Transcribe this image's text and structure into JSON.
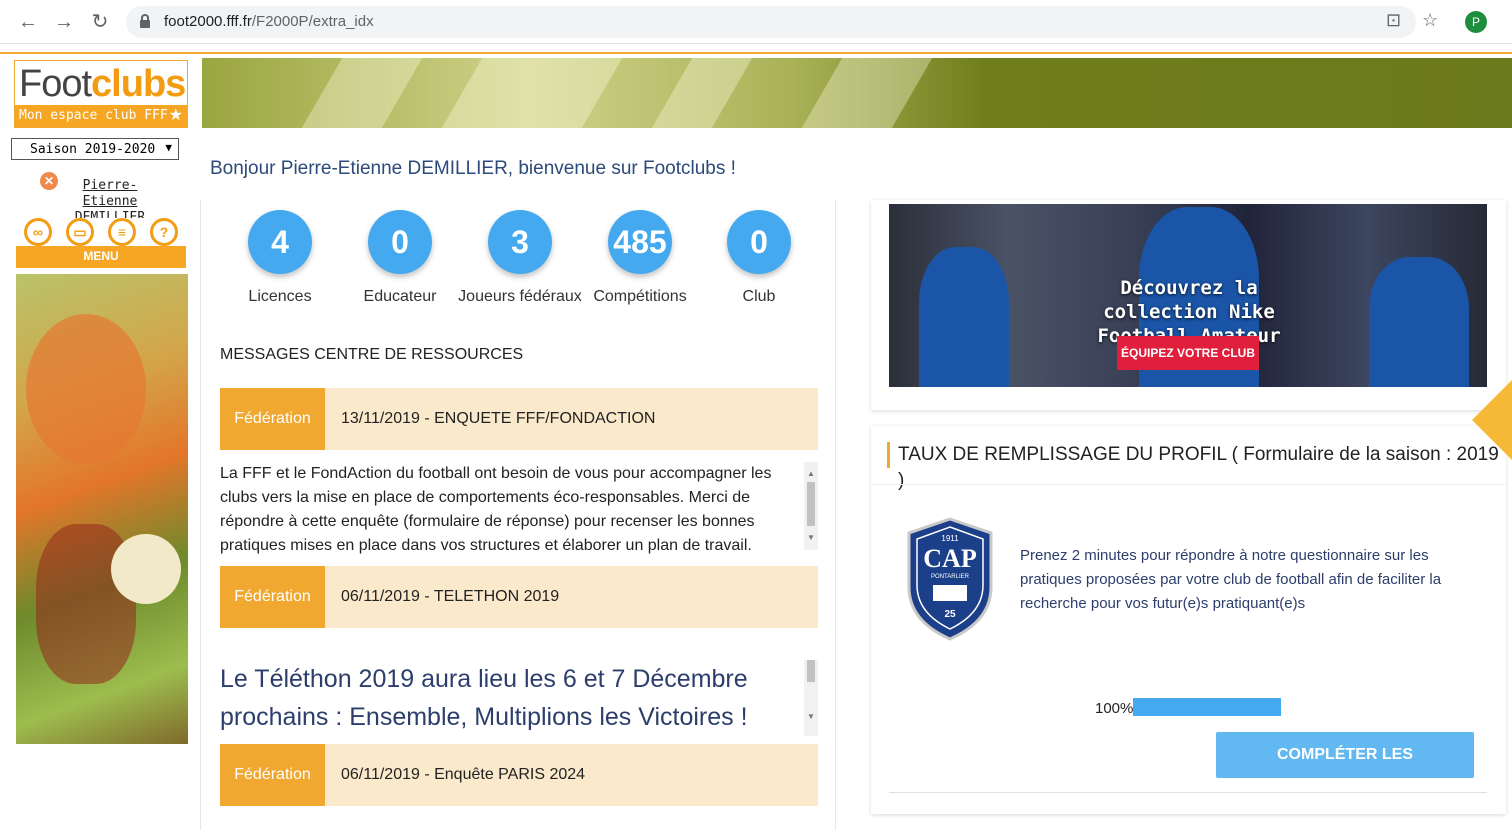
{
  "browser": {
    "url_host": "foot2000.fff.fr",
    "url_path": "/F2000P/extra_idx",
    "profile_initial": "P"
  },
  "sidebar": {
    "logo_part1": "Foot",
    "logo_part2": "clubs",
    "logo_sub": "Mon espace club FFF",
    "season": "Saison 2019-2020",
    "user_name": "Pierre-Etienne DEMILLIER",
    "menu_label": "MENU"
  },
  "welcome": "Bonjour Pierre-Etienne DEMILLIER, bienvenue sur Footclubs !",
  "stats": [
    {
      "value": "4",
      "label": "Licences"
    },
    {
      "value": "0",
      "label": "Educateur"
    },
    {
      "value": "3",
      "label": "Joueurs fédéraux"
    },
    {
      "value": "485",
      "label": "Compétitions"
    },
    {
      "value": "0",
      "label": "Club"
    }
  ],
  "messages": {
    "section_title": "MESSAGES CENTRE DE RESSOURCES",
    "items": [
      {
        "tag": "Fédération",
        "title": "13/11/2019 - ENQUETE FFF/FONDACTION",
        "body": "La FFF et le FondAction du football ont besoin de vous pour accompagner les clubs vers la mise en place de comportements éco-responsables. Merci de répondre à cette enquête (formulaire de réponse) pour recenser les bonnes pratiques mises en place dans vos structures et élaborer un plan de travail."
      },
      {
        "tag": "Fédération",
        "title": "06/11/2019 - TELETHON 2019",
        "body": "Le Téléthon 2019 aura lieu les 6 et 7 Décembre prochains : Ensemble, Multiplions les Victoires !"
      },
      {
        "tag": "Fédération",
        "title": "06/11/2019 - Enquête PARIS 2024",
        "body": ""
      }
    ]
  },
  "ad": {
    "headline": "Découvrez la collection Nike Football Amateur",
    "cta": "ÉQUIPEZ VOTRE CLUB"
  },
  "profile": {
    "title": "TAUX DE REMPLISSAGE DU PROFIL ( Formulaire de la saison : 2019 )",
    "badge_year": "1911",
    "badge_name": "CAP",
    "badge_sub": "PONTARLIER",
    "badge_num": "25",
    "text": "Prenez 2 minutes pour répondre à notre questionnaire sur les pratiques proposées par votre club de football afin de faciliter la recherche pour vos futur(e)s pratiquant(e)s",
    "progress_label": "100%",
    "progress_value": 1.0,
    "button": "COMPLÉTER LES INFORMATIONS"
  },
  "colors": {
    "accent_orange": "#f0a830",
    "stat_blue": "#45a9ef",
    "ad_red": "#e01f3d"
  }
}
